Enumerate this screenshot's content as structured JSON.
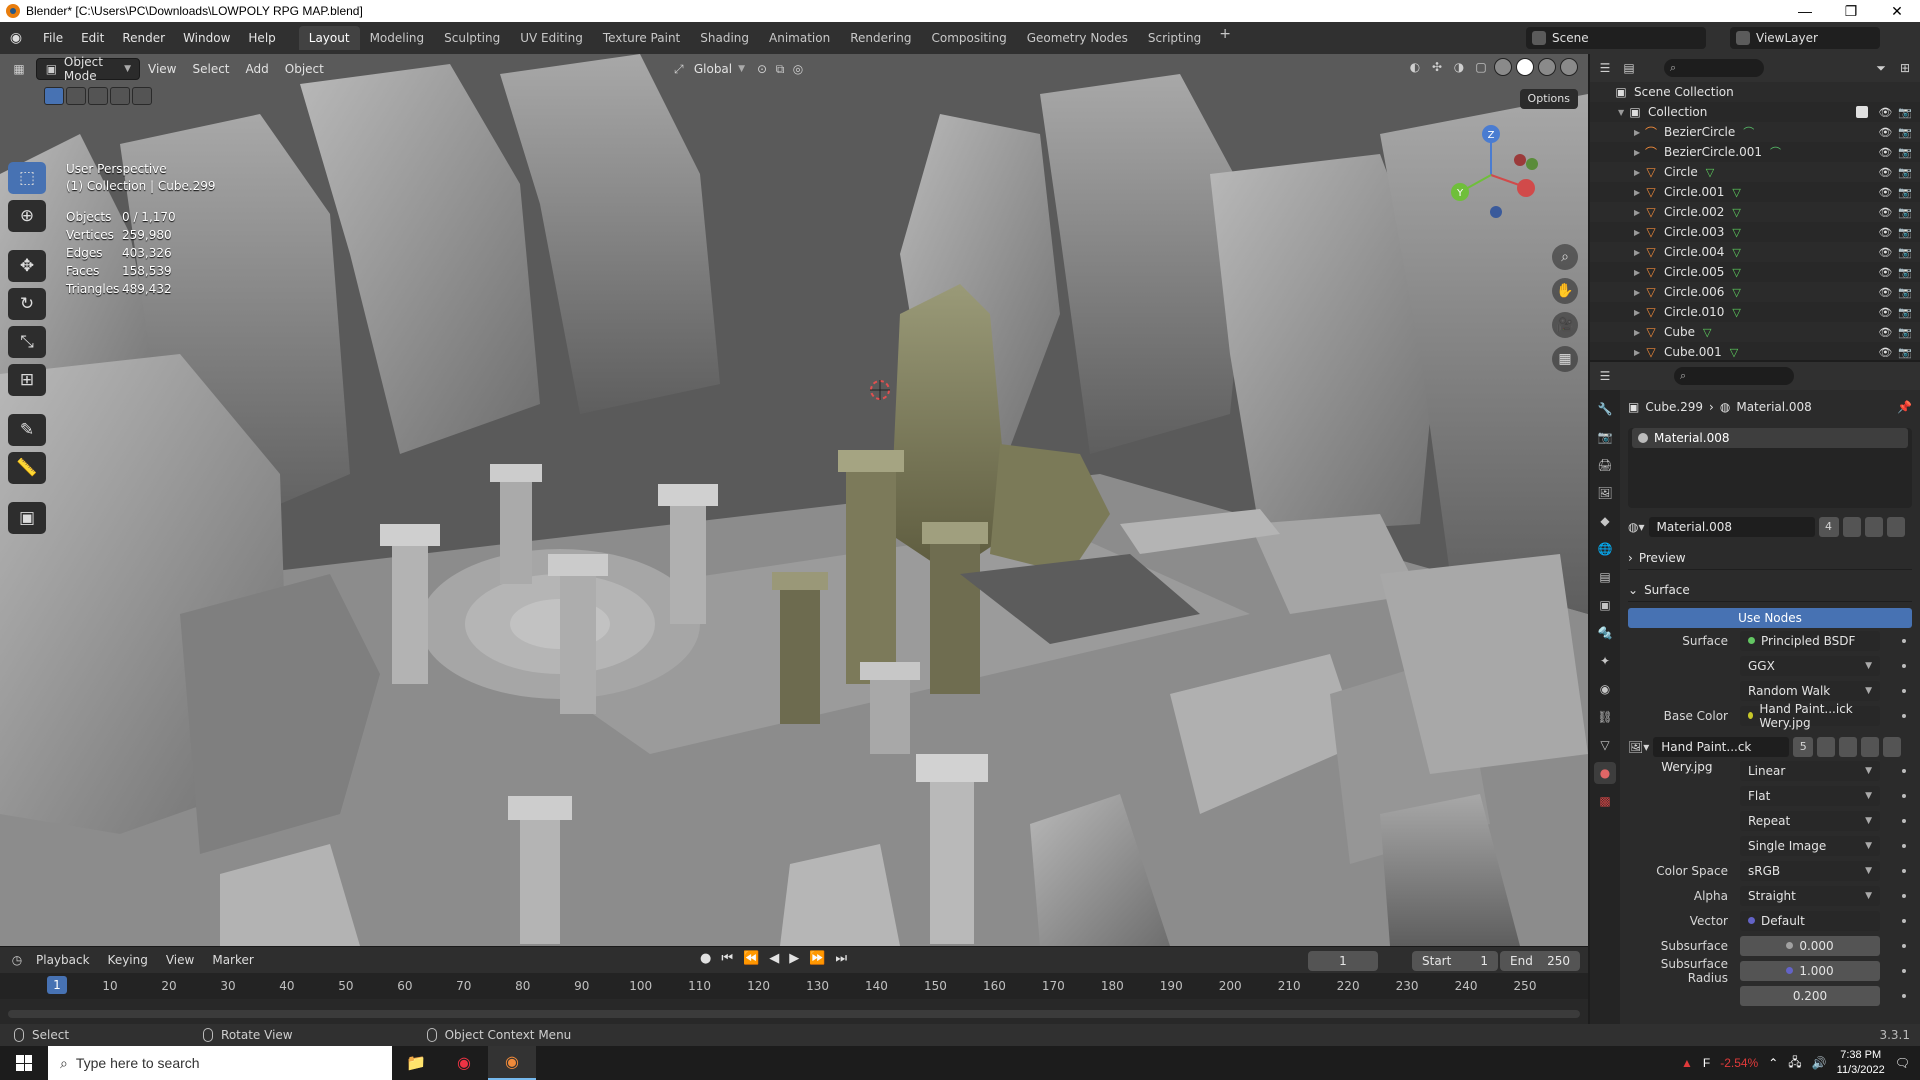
{
  "window": {
    "title": "Blender* [C:\\Users\\PC\\Downloads\\LOWPOLY RPG MAP.blend]",
    "minimize": "—",
    "maximize": "❐",
    "close": "✕"
  },
  "menus": [
    "File",
    "Edit",
    "Render",
    "Window",
    "Help"
  ],
  "workspaces": [
    "Layout",
    "Modeling",
    "Sculpting",
    "UV Editing",
    "Texture Paint",
    "Shading",
    "Animation",
    "Rendering",
    "Compositing",
    "Geometry Nodes",
    "Scripting"
  ],
  "workspace_add": "+",
  "scene": {
    "name": "Scene",
    "view_layer": "ViewLayer"
  },
  "viewport_header": {
    "mode": "Object Mode",
    "menus": [
      "View",
      "Select",
      "Add",
      "Object"
    ],
    "transform_orientation": "Global",
    "options": "Options"
  },
  "overlay": {
    "perspective": "User Perspective",
    "collection": "(1) Collection | Cube.299",
    "stats": [
      {
        "label": "Objects",
        "value": "0 / 1,170"
      },
      {
        "label": "Vertices",
        "value": "259,980"
      },
      {
        "label": "Edges",
        "value": "403,326"
      },
      {
        "label": "Faces",
        "value": "158,539"
      },
      {
        "label": "Triangles",
        "value": "489,432"
      }
    ]
  },
  "gizmo": {
    "x": "X",
    "y": "Y",
    "z": "Z"
  },
  "timeline": {
    "menus": [
      "Playback",
      "Keying",
      "View",
      "Marker"
    ],
    "current_frame": "1",
    "start_label": "Start",
    "start": "1",
    "end_label": "End",
    "end": "250",
    "ticks": [
      "1",
      "10",
      "20",
      "30",
      "40",
      "50",
      "60",
      "70",
      "80",
      "90",
      "100",
      "110",
      "120",
      "130",
      "140",
      "150",
      "160",
      "170",
      "180",
      "190",
      "200",
      "210",
      "220",
      "230",
      "240",
      "250"
    ]
  },
  "statusbar": {
    "select": "Select",
    "rotate": "Rotate View",
    "context": "Object Context Menu",
    "version": "3.3.1"
  },
  "outliner": {
    "root": "Scene Collection",
    "collection": "Collection",
    "items": [
      {
        "name": "BezierCircle",
        "type": "curve"
      },
      {
        "name": "BezierCircle.001",
        "type": "curve"
      },
      {
        "name": "Circle",
        "type": "mesh"
      },
      {
        "name": "Circle.001",
        "type": "mesh"
      },
      {
        "name": "Circle.002",
        "type": "mesh"
      },
      {
        "name": "Circle.003",
        "type": "mesh"
      },
      {
        "name": "Circle.004",
        "type": "mesh"
      },
      {
        "name": "Circle.005",
        "type": "mesh"
      },
      {
        "name": "Circle.006",
        "type": "mesh"
      },
      {
        "name": "Circle.010",
        "type": "mesh"
      },
      {
        "name": "Cube",
        "type": "mesh"
      },
      {
        "name": "Cube.001",
        "type": "mesh"
      }
    ]
  },
  "properties": {
    "object": "Cube.299",
    "material": "Material.008",
    "slot": "Material.008",
    "users": "4",
    "preview_label": "Preview",
    "surface_panel": "Surface",
    "use_nodes": "Use Nodes",
    "rows": [
      {
        "label": "Surface",
        "value": "Principled BSDF",
        "socket": "green",
        "kind": "link"
      },
      {
        "label": "",
        "value": "GGX",
        "kind": "select"
      },
      {
        "label": "",
        "value": "Random Walk",
        "kind": "select"
      },
      {
        "label": "Base Color",
        "value": "Hand Paint...ick Wery.jpg",
        "socket": "yellow",
        "kind": "link"
      }
    ],
    "image": {
      "name": "Hand Paint...ck Wery.jpg",
      "users": "5"
    },
    "image_rows": [
      {
        "label": "",
        "value": "Linear"
      },
      {
        "label": "",
        "value": "Flat"
      },
      {
        "label": "",
        "value": "Repeat"
      },
      {
        "label": "",
        "value": "Single Image"
      }
    ],
    "extra_rows": [
      {
        "label": "Color Space",
        "value": "sRGB",
        "kind": "select"
      },
      {
        "label": "Alpha",
        "value": "Straight",
        "kind": "select"
      },
      {
        "label": "Vector",
        "value": "Default",
        "socket": "blue",
        "kind": "link"
      },
      {
        "label": "Subsurface",
        "value": "0.000",
        "socket": "grey",
        "kind": "num"
      },
      {
        "label": "Subsurface Radius",
        "value": "1.000",
        "socket": "blue",
        "kind": "num"
      },
      {
        "label": "",
        "value": "0.200",
        "kind": "num"
      }
    ]
  },
  "taskbar": {
    "search_placeholder": "Type here to search",
    "weather": "F",
    "stock": "-2.54%",
    "time": "7:38 PM",
    "date": "11/3/2022"
  }
}
